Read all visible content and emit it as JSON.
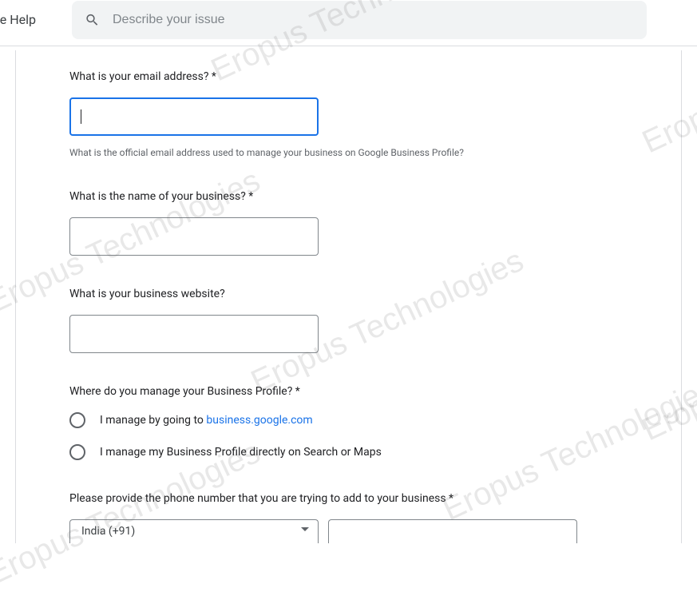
{
  "header": {
    "help_label": "ile Help",
    "search_placeholder": "Describe your issue"
  },
  "form": {
    "email": {
      "label": "What is your email address? *",
      "value": "",
      "help_text": "What is the official email address used to manage your business on Google Business Profile?"
    },
    "business_name": {
      "label": "What is the name of your business? *",
      "value": ""
    },
    "website": {
      "label": "What is your business website?",
      "value": ""
    },
    "manage_location": {
      "label": "Where do you manage your Business Profile? *",
      "option1_prefix": "I manage by going to ",
      "option1_link": "business.google.com",
      "option2": "I manage my Business Profile directly on Search or Maps"
    },
    "phone": {
      "label": "Please provide the phone number that you are trying to add to your business *",
      "country_code": "India (+91)"
    }
  },
  "watermark_text": "Eropus Technologies"
}
